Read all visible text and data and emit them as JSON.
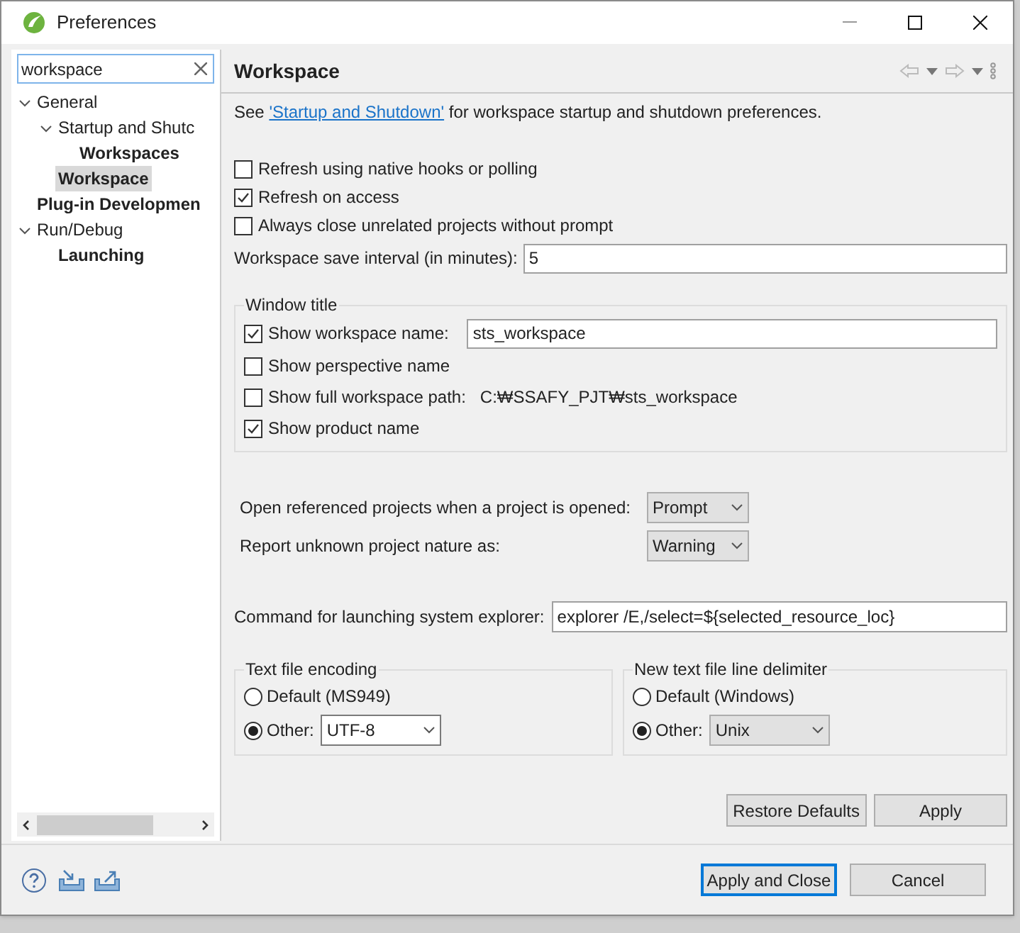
{
  "window": {
    "title": "Preferences"
  },
  "filter": {
    "value": "workspace"
  },
  "tree": [
    {
      "label": "General",
      "bold": false,
      "selected": false,
      "expanded": true,
      "children": [
        {
          "label": "Startup and Shutc",
          "bold": false,
          "selected": false,
          "expanded": true,
          "children": [
            {
              "label": "Workspaces",
              "bold": true,
              "selected": false
            }
          ]
        },
        {
          "label": "Workspace",
          "bold": true,
          "selected": true
        }
      ]
    },
    {
      "label": "Plug-in Developmen",
      "bold": true,
      "selected": false
    },
    {
      "label": "Run/Debug",
      "bold": false,
      "selected": false,
      "expanded": true,
      "children": [
        {
          "label": "Launching",
          "bold": true,
          "selected": false
        }
      ]
    }
  ],
  "page": {
    "title": "Workspace",
    "intro": {
      "before": "See",
      "link": "'Startup and Shutdown'",
      "after": "for workspace startup and shutdown preferences."
    },
    "options": [
      {
        "label": "Refresh using native hooks or polling",
        "checked": false
      },
      {
        "label": "Refresh on access",
        "checked": true
      },
      {
        "label": "Always close unrelated projects without prompt",
        "checked": false
      }
    ],
    "save_interval": {
      "label": "Workspace save interval (in minutes):",
      "value": "5"
    },
    "window_title": {
      "legend": "Window title",
      "items": [
        {
          "kind": "field",
          "label": "Show workspace name:",
          "checked": true,
          "value": "sts_workspace"
        },
        {
          "kind": "plain",
          "label": "Show perspective name",
          "checked": false
        },
        {
          "kind": "path",
          "label": "Show full workspace path:",
          "checked": false,
          "path": "C:₩SSAFY_PJT₩sts_workspace"
        },
        {
          "kind": "plain",
          "label": "Show product name",
          "checked": true
        }
      ]
    },
    "dropdowns": [
      {
        "label": "Open referenced projects when a project is opened:",
        "value": "Prompt"
      },
      {
        "label": "Report unknown project nature as:",
        "value": "Warning"
      }
    ],
    "explorer": {
      "label": "Command for launching system explorer:",
      "value": "explorer /E,/select=${selected_resource_loc}"
    },
    "groups": [
      {
        "legend": "Text file encoding",
        "options": [
          {
            "kind": "plain",
            "label": "Default (MS949)",
            "selected": false
          },
          {
            "kind": "select",
            "label": "Other:",
            "selected": true,
            "value": "UTF-8",
            "editable": true
          }
        ]
      },
      {
        "legend": "New text file line delimiter",
        "options": [
          {
            "kind": "plain",
            "label": "Default (Windows)",
            "selected": false
          },
          {
            "kind": "select",
            "label": "Other:",
            "selected": true,
            "value": "Unix",
            "editable": false
          }
        ]
      }
    ],
    "buttons": [
      "Restore Defaults",
      "Apply"
    ]
  },
  "footer": {
    "buttons": [
      {
        "label": "Apply and Close",
        "default": true
      },
      {
        "label": "Cancel",
        "default": false
      }
    ]
  }
}
